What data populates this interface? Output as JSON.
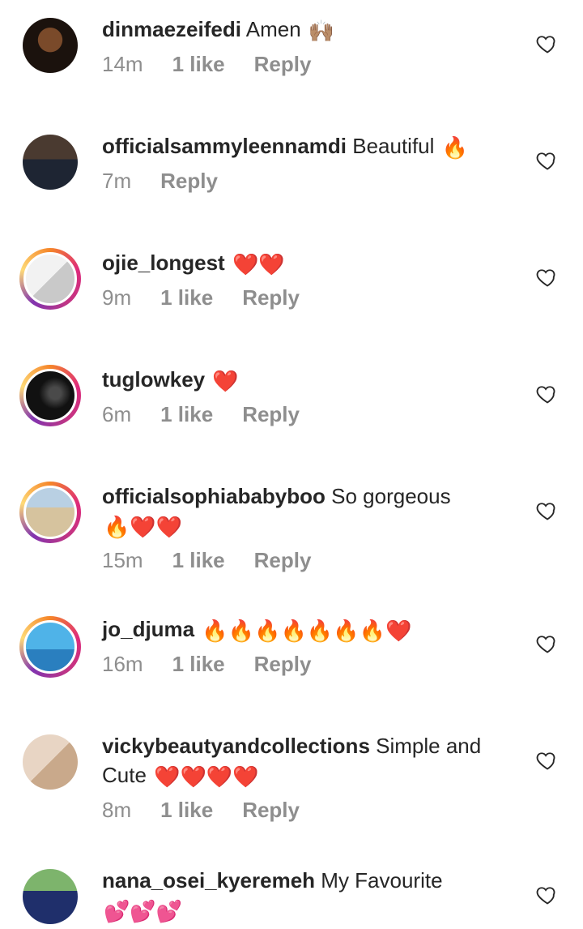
{
  "comments": [
    {
      "username": "dinmaezeifedi",
      "text": "Amen",
      "emoji": "🙌🏽",
      "time": "14m",
      "likes": "1 like",
      "reply": "Reply"
    },
    {
      "username": "officialsammyleennamdi",
      "text": "Beautiful",
      "emoji": "🔥",
      "time": "7m",
      "likes": "",
      "reply": "Reply"
    },
    {
      "username": "ojie_longest",
      "text": "",
      "emoji": "❤️❤️",
      "time": "9m",
      "likes": "1 like",
      "reply": "Reply"
    },
    {
      "username": "tuglowkey",
      "text": "",
      "emoji": "❤️",
      "time": "6m",
      "likes": "1 like",
      "reply": "Reply"
    },
    {
      "username": "officialsophiababyboo",
      "text": "So gorgeous",
      "emoji": "🔥❤️❤️",
      "time": "15m",
      "likes": "1 like",
      "reply": "Reply"
    },
    {
      "username": "jo_djuma",
      "text": "",
      "emoji": "🔥🔥🔥🔥🔥🔥🔥❤️",
      "time": "16m",
      "likes": "1 like",
      "reply": "Reply"
    },
    {
      "username": "vickybeautyandcollections",
      "text": "Simple and Cute",
      "emoji": "❤️❤️❤️❤️",
      "time": "8m",
      "likes": "1 like",
      "reply": "Reply"
    },
    {
      "username": "nana_osei_kyeremeh",
      "text": "My Favourite",
      "emoji": "💕💕💕",
      "time": "",
      "likes": "",
      "reply": ""
    }
  ],
  "colors": {
    "heart_red": "#e0245e",
    "meta_gray": "#8e8e8e",
    "text": "#262626"
  },
  "icons": {
    "like": "heart-outline-icon"
  }
}
